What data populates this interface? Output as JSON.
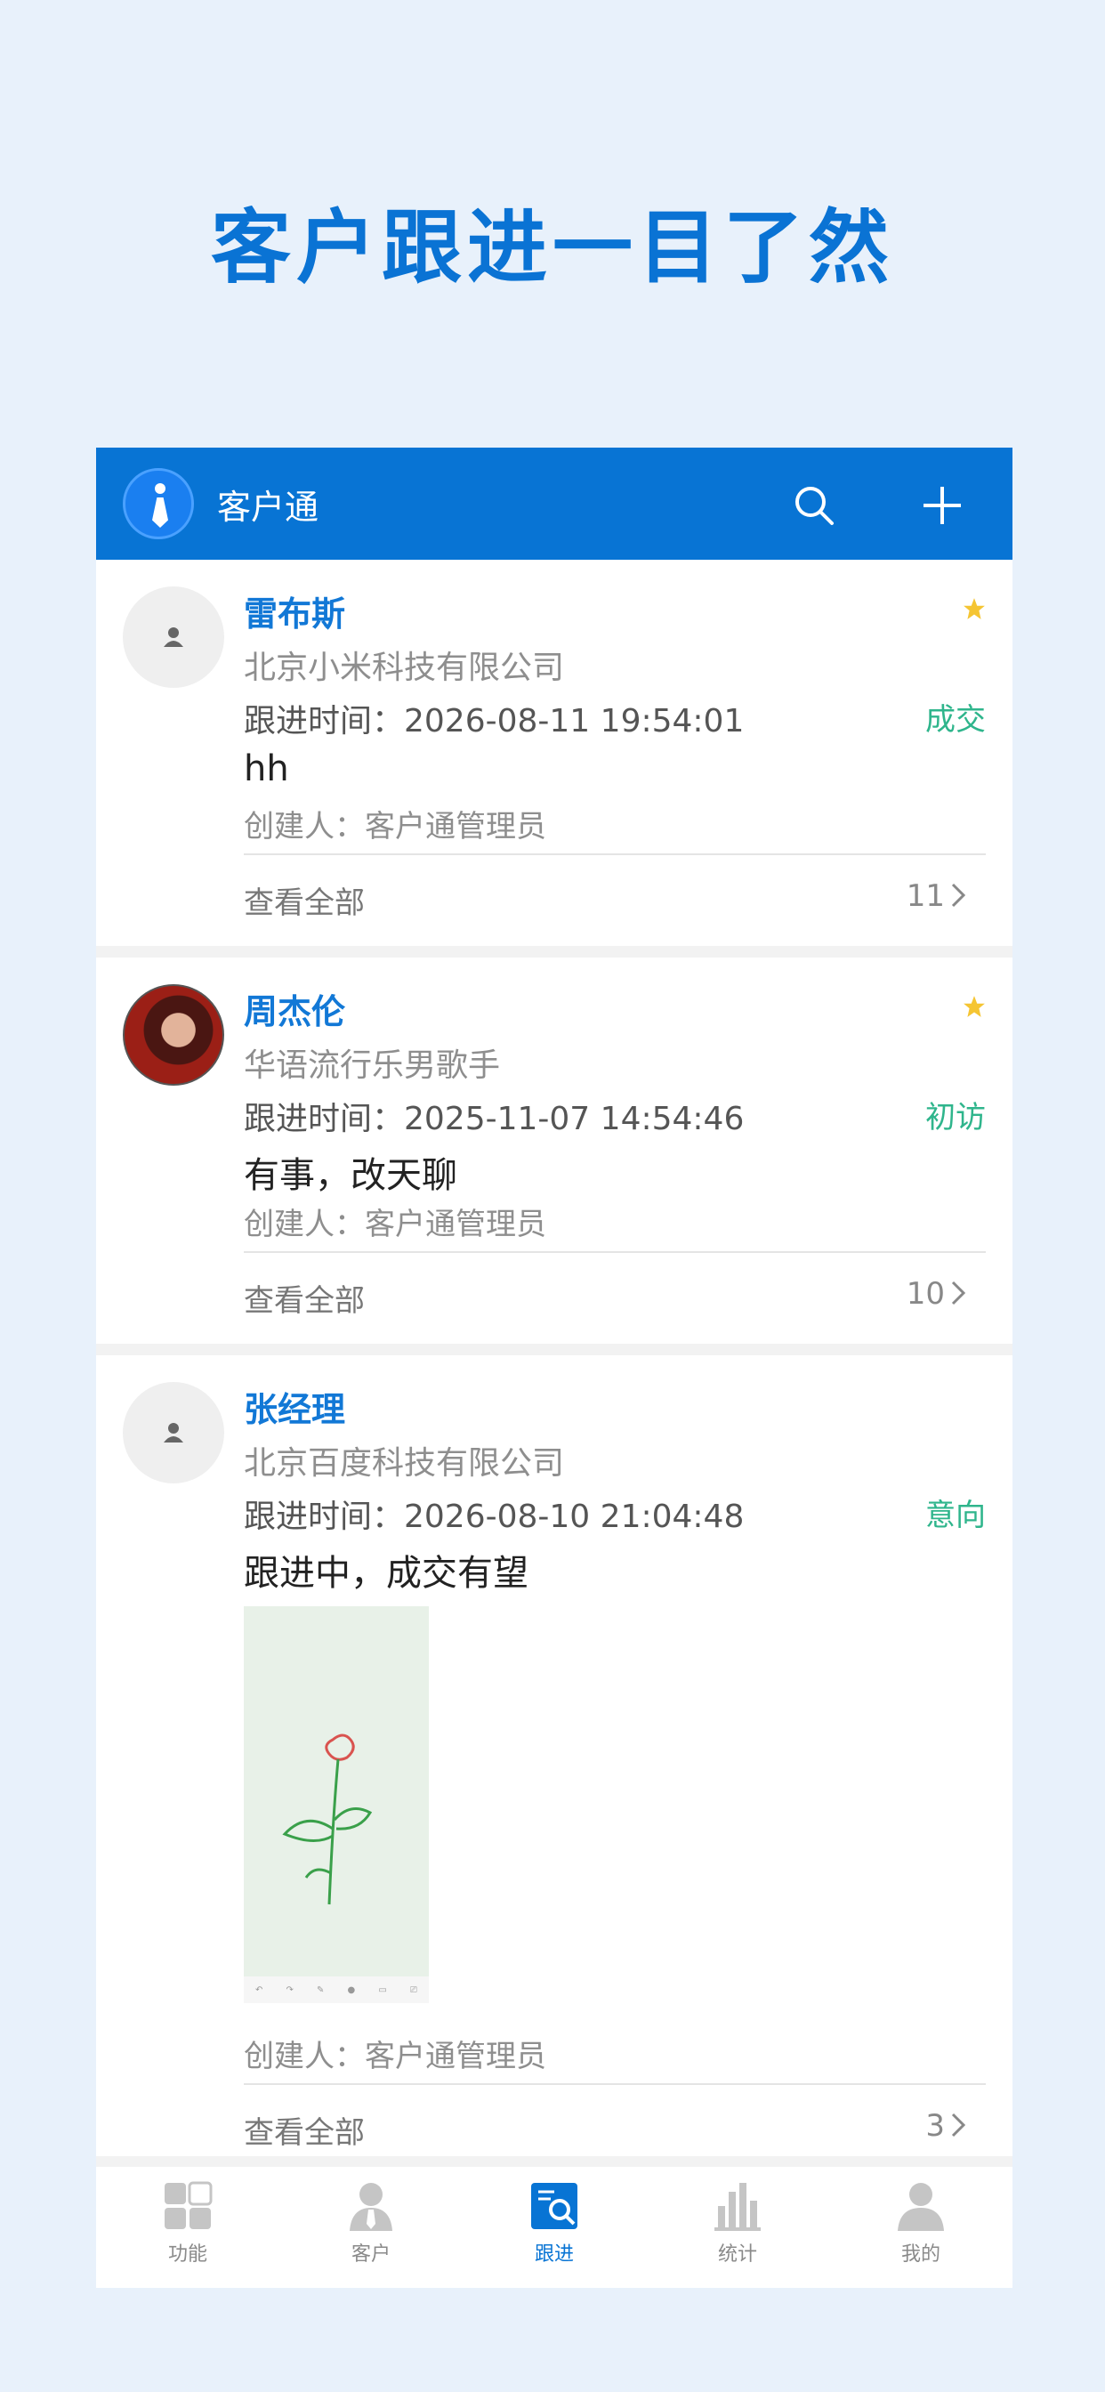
{
  "headline": "客户跟进一目了然",
  "app": {
    "title": "客户通"
  },
  "colors": {
    "brand": "#0874d4",
    "name": "#1278d6",
    "stage": "#2fb58c",
    "star": "#f5c533"
  },
  "cards": [
    {
      "name": "雷布斯",
      "company": "北京小米科技有限公司",
      "time": "跟进时间：2026-08-11 19:54:01",
      "stage": "成交",
      "content": "hh",
      "creator": "创建人：客户通管理员",
      "view_all": "查看全部",
      "count": "11",
      "starred": true
    },
    {
      "name": "周杰伦",
      "company": "华语流行乐男歌手",
      "time": "跟进时间：2025-11-07 14:54:46",
      "stage": "初访",
      "content": "有事，改天聊",
      "creator": "创建人：客户通管理员",
      "view_all": "查看全部",
      "count": "10",
      "starred": true
    },
    {
      "name": "张经理",
      "company": "北京百度科技有限公司",
      "time": "跟进时间：2026-08-10 21:04:48",
      "stage": "意向",
      "content": "跟进中，成交有望",
      "creator": "创建人：客户通管理员",
      "view_all": "查看全部",
      "count": "3",
      "starred": false
    }
  ],
  "tabs": [
    {
      "label": "功能",
      "icon": "grid-icon"
    },
    {
      "label": "客户",
      "icon": "customer-icon"
    },
    {
      "label": "跟进",
      "icon": "followup-icon",
      "active": true
    },
    {
      "label": "统计",
      "icon": "chart-icon"
    },
    {
      "label": "我的",
      "icon": "profile-icon"
    }
  ]
}
